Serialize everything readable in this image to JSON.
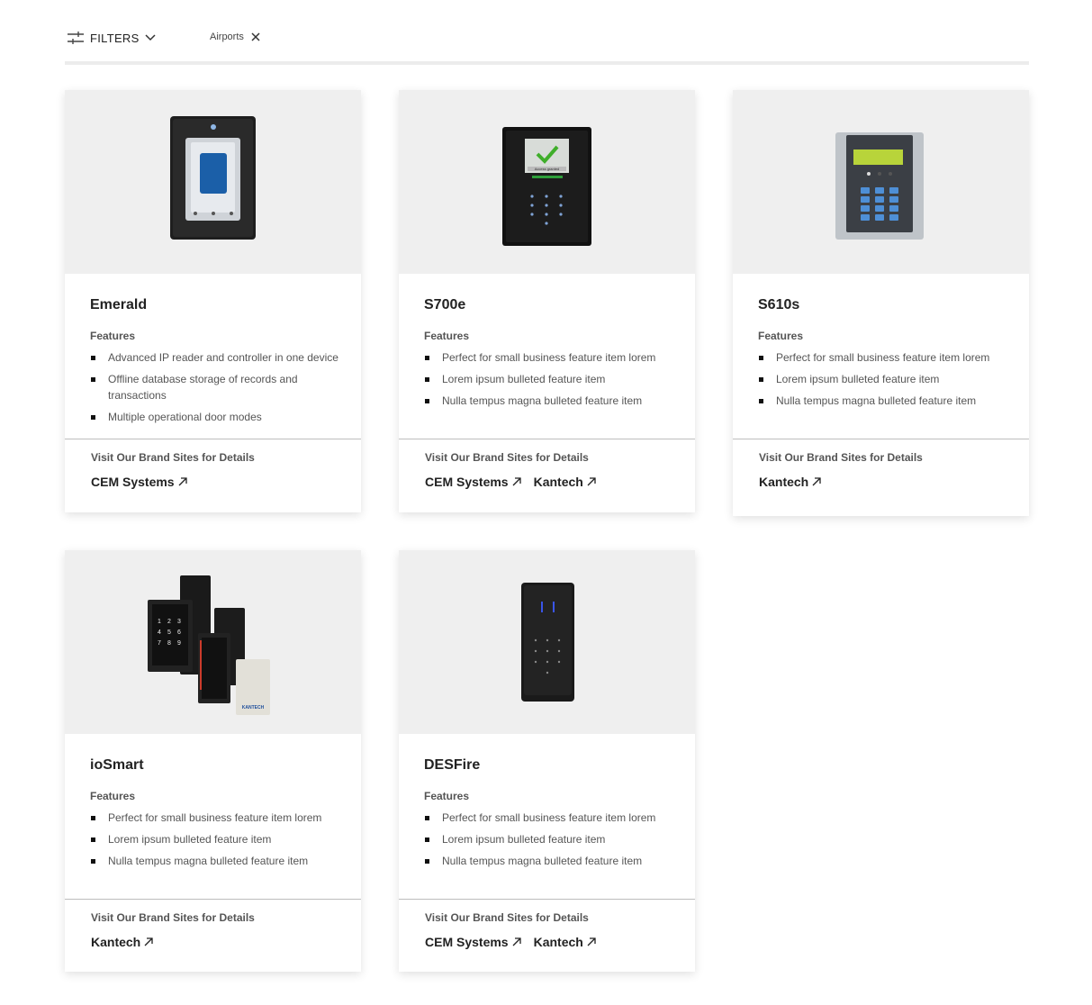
{
  "filters": {
    "label": "FILTERS",
    "active_chip": "Airports"
  },
  "features_heading": "Features",
  "brands_heading": "Visit Our Brand Sites for Details",
  "cards": [
    {
      "title": "Emerald",
      "features": [
        "Advanced IP reader and controller in one device",
        "Offline database storage of records and transactions",
        "Multiple operational door modes"
      ],
      "brands": [
        "CEM Systems"
      ],
      "image": "emerald-reader"
    },
    {
      "title": "S700e",
      "features": [
        "Perfect for small business feature item lorem",
        "Lorem ipsum bulleted feature item",
        "Nulla tempus magna bulleted feature item"
      ],
      "brands": [
        "CEM Systems",
        "Kantech"
      ],
      "image": "s700e-reader",
      "screen_text": "Access granted"
    },
    {
      "title": "S610s",
      "features": [
        "Perfect for small business feature item lorem",
        "Lorem ipsum bulleted feature item",
        "Nulla tempus magna bulleted feature item"
      ],
      "brands": [
        "Kantech"
      ],
      "image": "s610s-keypad-reader"
    },
    {
      "title": "ioSmart",
      "features": [
        "Perfect for small business feature item lorem",
        "Lorem ipsum bulleted feature item",
        "Nulla tempus magna bulleted feature item"
      ],
      "brands": [
        "Kantech"
      ],
      "image": "iosmart-readers",
      "card_logo": "KANTECH"
    },
    {
      "title": "DESFire",
      "features": [
        "Perfect for small business feature item lorem",
        "Lorem ipsum bulleted feature item",
        "Nulla tempus magna bulleted feature item"
      ],
      "brands": [
        "CEM Systems",
        "Kantech"
      ],
      "image": "desfire-reader"
    }
  ]
}
